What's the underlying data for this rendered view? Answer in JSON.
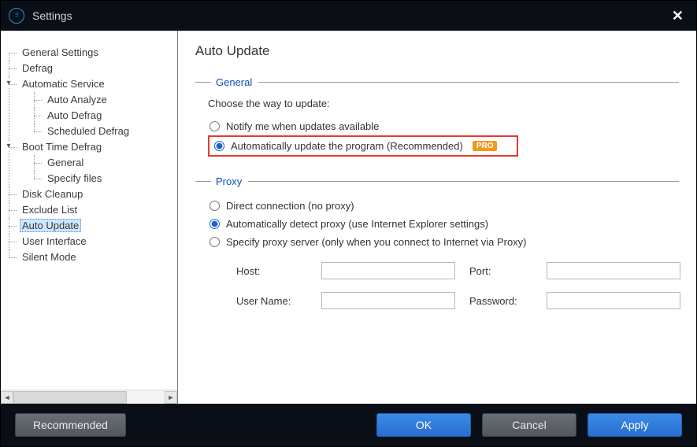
{
  "titlebar": {
    "title": "Settings",
    "close_glyph": "✕"
  },
  "sidebar": {
    "items": [
      {
        "label": "General Settings"
      },
      {
        "label": "Defrag"
      },
      {
        "label": "Automatic Service",
        "expanded": true,
        "children": [
          {
            "label": "Auto Analyze"
          },
          {
            "label": "Auto Defrag"
          },
          {
            "label": "Scheduled Defrag"
          }
        ]
      },
      {
        "label": "Boot Time Defrag",
        "expanded": true,
        "children": [
          {
            "label": "General"
          },
          {
            "label": "Specify files"
          }
        ]
      },
      {
        "label": "Disk Cleanup"
      },
      {
        "label": "Exclude List"
      },
      {
        "label": "Auto Update",
        "selected": true
      },
      {
        "label": "User Interface"
      },
      {
        "label": "Silent Mode"
      }
    ]
  },
  "page": {
    "heading": "Auto Update",
    "general": {
      "legend": "General",
      "lead": "Choose the way to update:",
      "opt_notify": "Notify me when updates available",
      "opt_auto": "Automatically update the program (Recommended)",
      "pro_badge": "PRO"
    },
    "proxy": {
      "legend": "Proxy",
      "opt_direct": "Direct connection (no proxy)",
      "opt_auto": "Automatically detect proxy (use Internet Explorer settings)",
      "opt_specify": "Specify proxy server (only when you connect to Internet via Proxy)",
      "host_label": "Host:",
      "port_label": "Port:",
      "user_label": "User Name:",
      "pass_label": "Password:",
      "host_value": "",
      "port_value": "",
      "user_value": "",
      "pass_value": ""
    }
  },
  "footer": {
    "recommended": "Recommended",
    "ok": "OK",
    "cancel": "Cancel",
    "apply": "Apply"
  }
}
